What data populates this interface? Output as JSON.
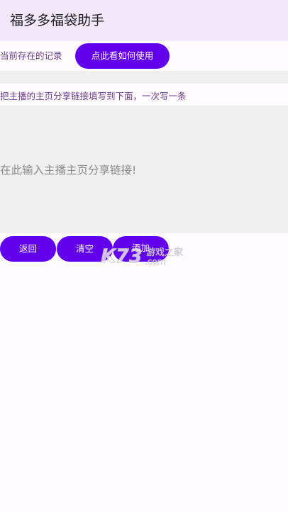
{
  "app": {
    "title": "福多多福袋助手"
  },
  "records": {
    "label": "当前存在的记录",
    "help_button_label": "点此看如何使用"
  },
  "input_section": {
    "instruction": "把主播的主页分享链接填写到下面，一次写一条",
    "placeholder": "在此输入主播主页分享链接!",
    "value": ""
  },
  "actions": {
    "back_label": "返回",
    "clear_label": "清空",
    "add_label": "添加"
  },
  "watermark": {
    "logo_text": "K73",
    "tagline": "游戏之家",
    "domain": ".com"
  },
  "colors": {
    "accent": "#6200ee",
    "appbar_bg": "#f1e8fa",
    "field_bg": "#efefef",
    "label_text": "#6a3d8c"
  }
}
